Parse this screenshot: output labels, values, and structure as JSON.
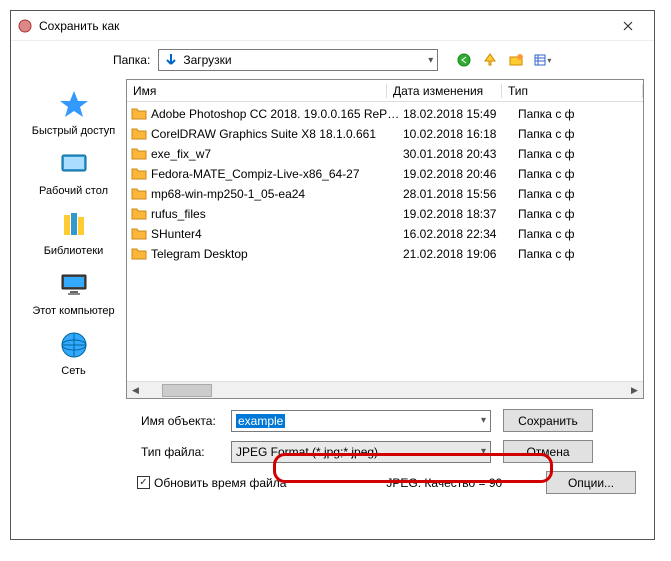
{
  "titlebar": {
    "title": "Сохранить как"
  },
  "folder": {
    "label": "Папка:",
    "current": "Загрузки"
  },
  "nav_icons": [
    "back-icon",
    "up-icon",
    "new-folder-icon",
    "view-icon"
  ],
  "sidebar": [
    {
      "icon": "quick-access",
      "label": "Быстрый доступ"
    },
    {
      "icon": "desktop",
      "label": "Рабочий стол"
    },
    {
      "icon": "libraries",
      "label": "Библиотеки"
    },
    {
      "icon": "this-pc",
      "label": "Этот компьютер"
    },
    {
      "icon": "network",
      "label": "Сеть"
    }
  ],
  "columns": {
    "name": "Имя",
    "date": "Дата изменения",
    "type": "Тип"
  },
  "rows": [
    {
      "name": "Adobe Photoshop CC 2018. 19.0.0.165 RePa...",
      "date": "18.02.2018 15:49",
      "type": "Папка с ф"
    },
    {
      "name": "CorelDRAW Graphics Suite X8 18.1.0.661",
      "date": "10.02.2018 16:18",
      "type": "Папка с ф"
    },
    {
      "name": "exe_fix_w7",
      "date": "30.01.2018 20:43",
      "type": "Папка с ф"
    },
    {
      "name": "Fedora-MATE_Compiz-Live-x86_64-27",
      "date": "19.02.2018 20:46",
      "type": "Папка с ф"
    },
    {
      "name": "mp68-win-mp250-1_05-ea24",
      "date": "28.01.2018 15:56",
      "type": "Папка с ф"
    },
    {
      "name": "rufus_files",
      "date": "19.02.2018 18:37",
      "type": "Папка с ф"
    },
    {
      "name": "SHunter4",
      "date": "16.02.2018 22:34",
      "type": "Папка с ф"
    },
    {
      "name": "Telegram Desktop",
      "date": "21.02.2018 19:06",
      "type": "Папка с ф"
    }
  ],
  "form": {
    "filename_label": "Имя объекта:",
    "filename_value": "example",
    "filetype_label": "Тип файла:",
    "filetype_value": "JPEG Format (*.jpg;*.jpeg)",
    "save": "Сохранить",
    "cancel": "Отмена",
    "options": "Опции..."
  },
  "bottom": {
    "checkbox": "Обновить время файла",
    "checked": true,
    "quality": "JPEG: Качество = 90"
  }
}
